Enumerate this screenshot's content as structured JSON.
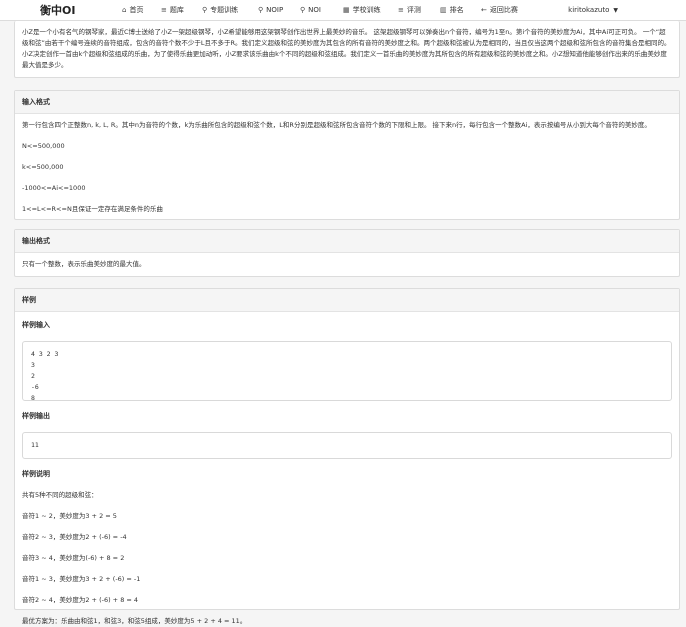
{
  "nav": {
    "brand": "衡中OI",
    "items": [
      {
        "label": "首页",
        "icon": "home-icon",
        "glyph": "⌂"
      },
      {
        "label": "题库",
        "icon": "list-icon",
        "glyph": "≡"
      },
      {
        "label": "专题训练",
        "icon": "bike-icon",
        "glyph": "⚲"
      },
      {
        "label": "NOIP",
        "icon": "bike-icon",
        "glyph": "⚲"
      },
      {
        "label": "NOI",
        "icon": "bike-icon",
        "glyph": "⚲"
      },
      {
        "label": "学校训练",
        "icon": "building-icon",
        "glyph": "▦"
      },
      {
        "label": "评测",
        "icon": "list-icon",
        "glyph": "≡"
      },
      {
        "label": "排名",
        "icon": "chart-icon",
        "glyph": "▥"
      },
      {
        "label": "返回比赛",
        "icon": "back-arrow-icon",
        "glyph": "←"
      }
    ],
    "user": "kiritokazuto"
  },
  "description": {
    "text": "小Z是一个小有名气的钢琴家，最近C博士送给了小Z一架超级钢琴，小Z希望能够用这架钢琴创作出世界上最美妙的音乐。 这架超级钢琴可以弹奏出n个音符，编号为1至n。第i个音符的美妙度为Ai，其中Ai可正可负。 一个“超级和弦”由若干个编号连续的音符组成，包含的音符个数不少于L且不多于R。我们定义超级和弦的美妙度为其包含的所有音符的美妙度之和。两个超级和弦被认为是相同的，当且仅当这两个超级和弦所包含的音符集合是相同的。 小Z决定创作一首由k个超级和弦组成的乐曲，为了使得乐曲更加动听，小Z要求该乐曲由k个不同的超级和弦组成。我们定义一首乐曲的美妙度为其所包含的所有超级和弦的美妙度之和。小Z想知道他能够创作出来的乐曲美妙度最大值是多少。"
  },
  "input_format": {
    "title": "输入格式",
    "intro": "第一行包含四个正整数n, k, L, R。其中n为音符的个数，k为乐曲所包含的超级和弦个数，L和R分别是超级和弦所包含音符个数的下限和上限。 接下来n行，每行包含一个整数Ai，表示按编号从小到大每个音符的美妙度。",
    "c1": "N<=500,000",
    "c2": "k<=500,000",
    "c3": "-1000<=Ai<=1000",
    "c4": "1<=L<=R<=N且保证一定存在满足条件的乐曲"
  },
  "output_format": {
    "title": "输出格式",
    "text": "只有一个整数，表示乐曲美妙度的最大值。"
  },
  "sample": {
    "title": "样例",
    "input_title": "样例输入",
    "input": "4 3 2 3\n3\n2\n-6\n8",
    "output_title": "样例输出",
    "output": "11",
    "explain_title": "样例说明",
    "e0": "共有5种不同的超级和弦：",
    "e1": "音符1 ~ 2，美妙度为3 + 2 = 5",
    "e2": "音符2 ~ 3，美妙度为2 + (-6) = -4",
    "e3": "音符3 ~ 4，美妙度为(-6) + 8 = 2",
    "e4": "音符1 ~ 3，美妙度为3 + 2 + (-6) = -1",
    "e5": "音符2 ~ 4，美妙度为2 + (-6) + 8 = 4",
    "e6": "最优方案为：乐曲由和弦1，和弦3，和弦5组成，美妙度为5 + 2 + 4 = 11。"
  }
}
